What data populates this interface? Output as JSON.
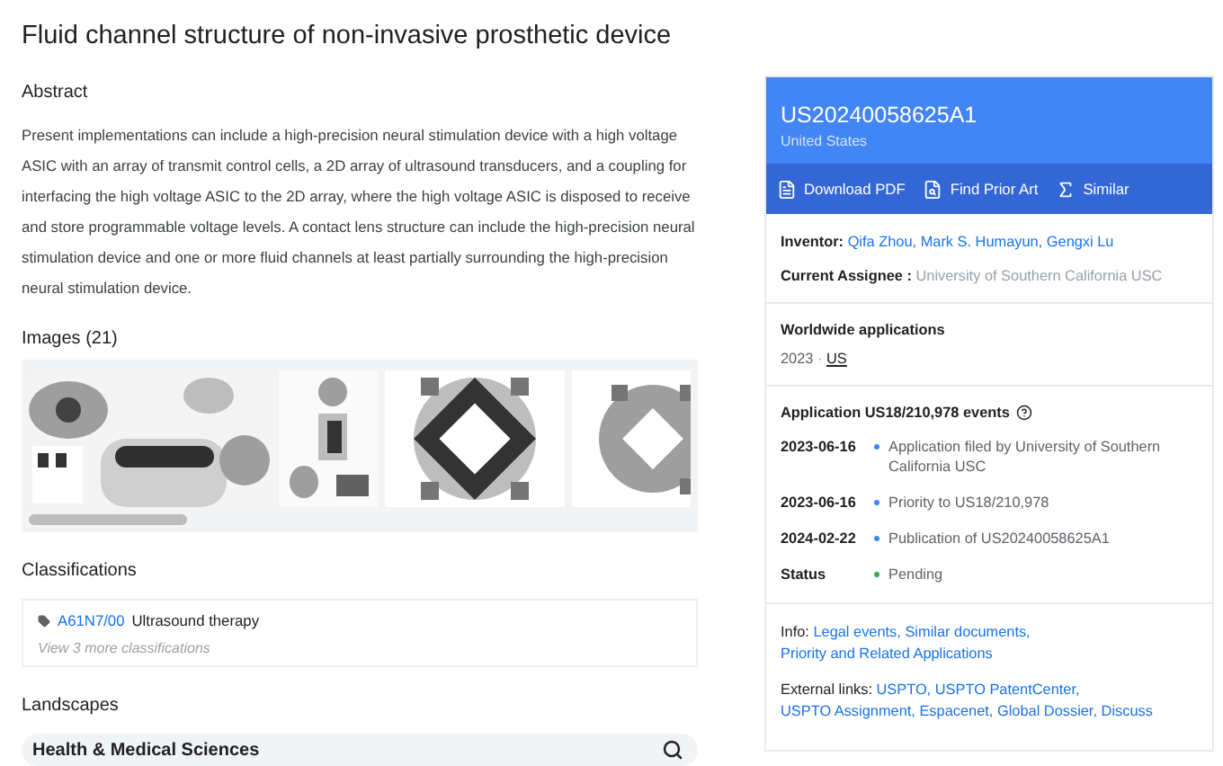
{
  "title": "Fluid channel structure of non-invasive prosthetic device",
  "abstract": {
    "heading": "Abstract",
    "text": "Present implementations can include a high-precision neural stimulation device with a high voltage ASIC with an array of transmit control cells, a 2D array of ultrasound transducers, and a coupling for interfacing the high voltage ASIC to the 2D array, where the high voltage ASIC is disposed to receive and store programmable voltage levels. A contact lens structure can include the high-precision neural stimulation device and one or more fluid channels at least partially surrounding the high-precision neural stimulation device."
  },
  "images": {
    "heading": "Images (21)"
  },
  "classifications": {
    "heading": "Classifications",
    "items": [
      {
        "code": "A61N7/00",
        "label": "Ultrasound therapy"
      }
    ],
    "more": "View 3 more classifications"
  },
  "landscapes": {
    "heading": "Landscapes",
    "items": [
      {
        "label": "Health & Medical Sciences"
      }
    ]
  },
  "patent": {
    "number": "US20240058625A1",
    "country": "United States",
    "actions": [
      {
        "kind": "pdf",
        "label": "Download PDF"
      },
      {
        "kind": "prior",
        "label": "Find Prior Art"
      },
      {
        "kind": "similar",
        "label": "Similar"
      }
    ],
    "inventor": {
      "label": "Inventor:",
      "names": [
        "Qifa Zhou,",
        "Mark S. Humayun,",
        "Gengxi Lu"
      ]
    },
    "assignee": {
      "label": "Current Assignee :",
      "value": "University of Southern California USC"
    },
    "worldwide": {
      "heading": "Worldwide applications",
      "year": "2023",
      "separator": "·",
      "country": "US"
    },
    "events": {
      "heading": "Application US18/210,978 events",
      "items": [
        {
          "date": "2023-06-16",
          "text": "Application filed by University of Southern California USC",
          "color": "#4285f4"
        },
        {
          "date": "2023-06-16",
          "text": "Priority to US18/210,978",
          "color": "#4285f4"
        },
        {
          "date": "2024-02-22",
          "text": "Publication of US20240058625A1",
          "color": "#4285f4"
        },
        {
          "date": "Status",
          "text": "Pending",
          "color": "#34a853"
        }
      ]
    },
    "info": {
      "label": "Info:",
      "links": [
        "Legal events,",
        "Similar documents,",
        "Priority and Related Applications"
      ]
    },
    "external": {
      "label": "External links:",
      "links": [
        "USPTO,",
        "USPTO PatentCenter,",
        "USPTO Assignment,",
        "Espacenet,",
        "Global Dossier,",
        "Discuss"
      ]
    }
  }
}
